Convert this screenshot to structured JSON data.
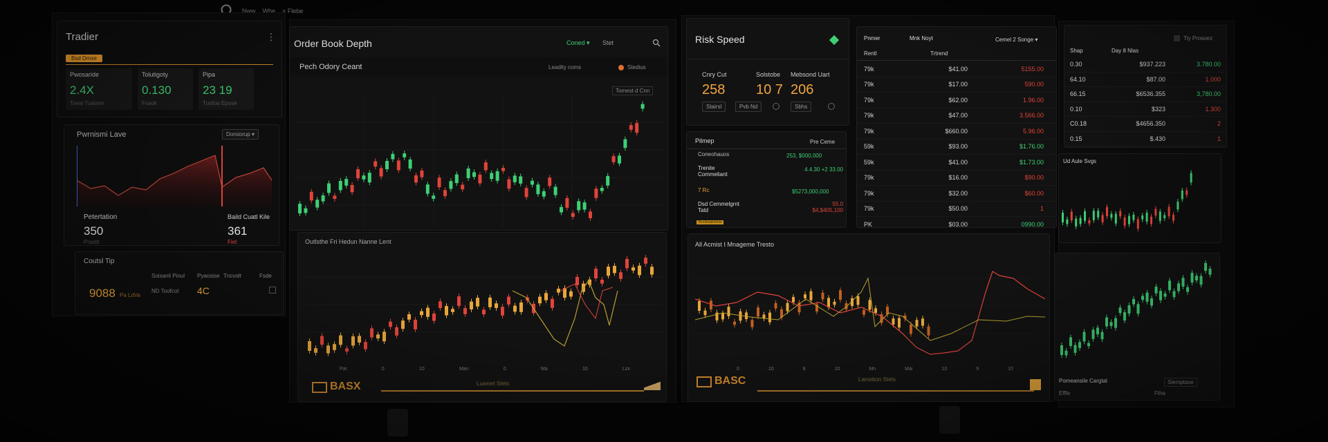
{
  "topbar": {
    "items": [
      "Nww",
      "Whe",
      "× Flebe"
    ]
  },
  "left": {
    "title": "Tradier",
    "tag": "Bsd Dmse",
    "stats": [
      {
        "label": "Pwosaride",
        "value": "2.4X",
        "sub": "Toeal Tuaisen"
      },
      {
        "label": "Tolutigoty",
        "value": "0.130",
        "sub": "Fsaok"
      },
      {
        "label": "Pipa",
        "value": "23 19",
        "sub": "Tuofoa Epose"
      }
    ],
    "chart_title": "Pwrnismi Lave",
    "chart_btn": "Dorsiorup ▾",
    "foot_left_label": "Petertation",
    "foot_left_value": "350",
    "foot_left_sub": "Prastit",
    "foot_right_label": "Baild Cuatl Kile",
    "foot_right_value": "361",
    "foot_right_sub": "Fiet",
    "tip_title": "Coutsl Tip",
    "tip_headers": [
      "Soisanli Pinul",
      "Pyaosise",
      "Tncvolt",
      "Fsde"
    ],
    "tip_value": "9088",
    "tip_badge": "Pa LdVa",
    "tip_mid": "ND Toofcot",
    "tip_val2": "4C"
  },
  "center": {
    "title": "Order Book Depth",
    "ctrl1": "Coned ▾",
    "ctrl2": "Stet",
    "subtitle": "Pech Odory Ceant",
    "sub_btn1": "Leadity coms",
    "sub_btn2": "Stedius",
    "candle_badge": "Tomest d Cnn",
    "chart2_title": "Outlsthe Fri Hedun Nanne Lent",
    "xticks": [
      "Pat",
      "0",
      "10",
      "Man",
      "0",
      "Ma",
      "10",
      "Lzx"
    ],
    "logo": "BASX",
    "logo_bar": "Luamet Stets"
  },
  "risk": {
    "title": "Risk Speed",
    "metrics": [
      {
        "label": "Cnry Cut",
        "value": "258",
        "btn": "Stairsl"
      },
      {
        "label": "Solstobe",
        "value": "10 7",
        "btn": "Pvb Nd"
      },
      {
        "label": "Mebsond Uart",
        "value": "206",
        "btn": "Sbhs"
      }
    ]
  },
  "pfiner": {
    "title": "Pilmep",
    "right_title": "Pre Ceme",
    "rows": [
      {
        "name": "Coneohauos",
        "value": "253, $000,000"
      },
      {
        "name": "Trenite Commeliant",
        "value": "4.4.30 +2 33.00"
      },
      {
        "name": "7 Rc",
        "value": "$5273,000,000"
      },
      {
        "name": "Dsd Cemmelgrnt Tatd",
        "value": "55.0 $4,$405,100"
      }
    ],
    "badge": "Tenotoaskstone"
  },
  "orders": {
    "headers": [
      "Pnmer",
      "Mnk Noyt",
      "Cemel 2 Songe ▾"
    ],
    "subheaders": [
      "Rentl",
      "Trtrend"
    ],
    "rows": [
      {
        "a": "79k",
        "b": "$41.00",
        "c": "5155.00",
        "cc": "red"
      },
      {
        "a": "79k",
        "b": "$17.00",
        "c": "590.00",
        "cc": "red"
      },
      {
        "a": "79k",
        "b": "$62.00",
        "c": "1.96.00",
        "cc": "red"
      },
      {
        "a": "79k",
        "b": "$47.00",
        "c": "3.566.00",
        "cc": "red"
      },
      {
        "a": "79k",
        "b": "$660.00",
        "c": "5.96.00",
        "cc": "red"
      },
      {
        "a": "59k",
        "b": "$93.00",
        "c": "$1.76.00",
        "cc": "green"
      },
      {
        "a": "59k",
        "b": "$41.00",
        "c": "$1.73.00",
        "cc": "green"
      },
      {
        "a": "79k",
        "b": "$16.00",
        "c": "$90.00",
        "cc": "red"
      },
      {
        "a": "79k",
        "b": "$32.00",
        "c": "$60.00",
        "cc": "red"
      },
      {
        "a": "79k",
        "b": "$50.00",
        "c": "1",
        "cc": "red"
      },
      {
        "a": "PK",
        "b": "$03.00",
        "c": "0990.00",
        "cc": "green"
      }
    ]
  },
  "ticker": {
    "headers": [
      "Shap",
      "Day 8 Nlas",
      "Tly Prosoez"
    ],
    "rows": [
      {
        "a": "0.30",
        "b": "$937.223",
        "c": "3.780.00",
        "cc": "green"
      },
      {
        "a": "64.10",
        "b": "$87.00",
        "c": "1.000",
        "cc": "red"
      },
      {
        "a": "66.15",
        "b": "$6536.355",
        "c": "3,780.00",
        "cc": "green"
      },
      {
        "a": "0.10",
        "b": "$323",
        "c": "1.300",
        "cc": "red"
      },
      {
        "a": "C0.18",
        "b": "$4656.350",
        "c": "2",
        "cc": "red"
      },
      {
        "a": "0.15",
        "b": "$.430",
        "c": "1",
        "cc": "red"
      }
    ]
  },
  "right": {
    "mini_title": "Ud Aule Svgs",
    "foot_title": "Pomeansile Cargtal",
    "foot_left": "Efffe",
    "foot_right": "Ftha",
    "foot_btn": "Siemptase"
  },
  "bottom_mid": {
    "title": "All Acmist I Mnageme Tresto",
    "xticks": [
      "0",
      "10",
      "8",
      "10",
      "Mn",
      "Mai",
      "10",
      "9",
      "10"
    ],
    "logo": "BASC",
    "logo_bar": "Lamebon Stets"
  },
  "colors": {
    "green": "#3ecf75",
    "red": "#e0443a",
    "orange": "#f0a640",
    "amber": "#e8a63a",
    "bg": "#050505"
  }
}
